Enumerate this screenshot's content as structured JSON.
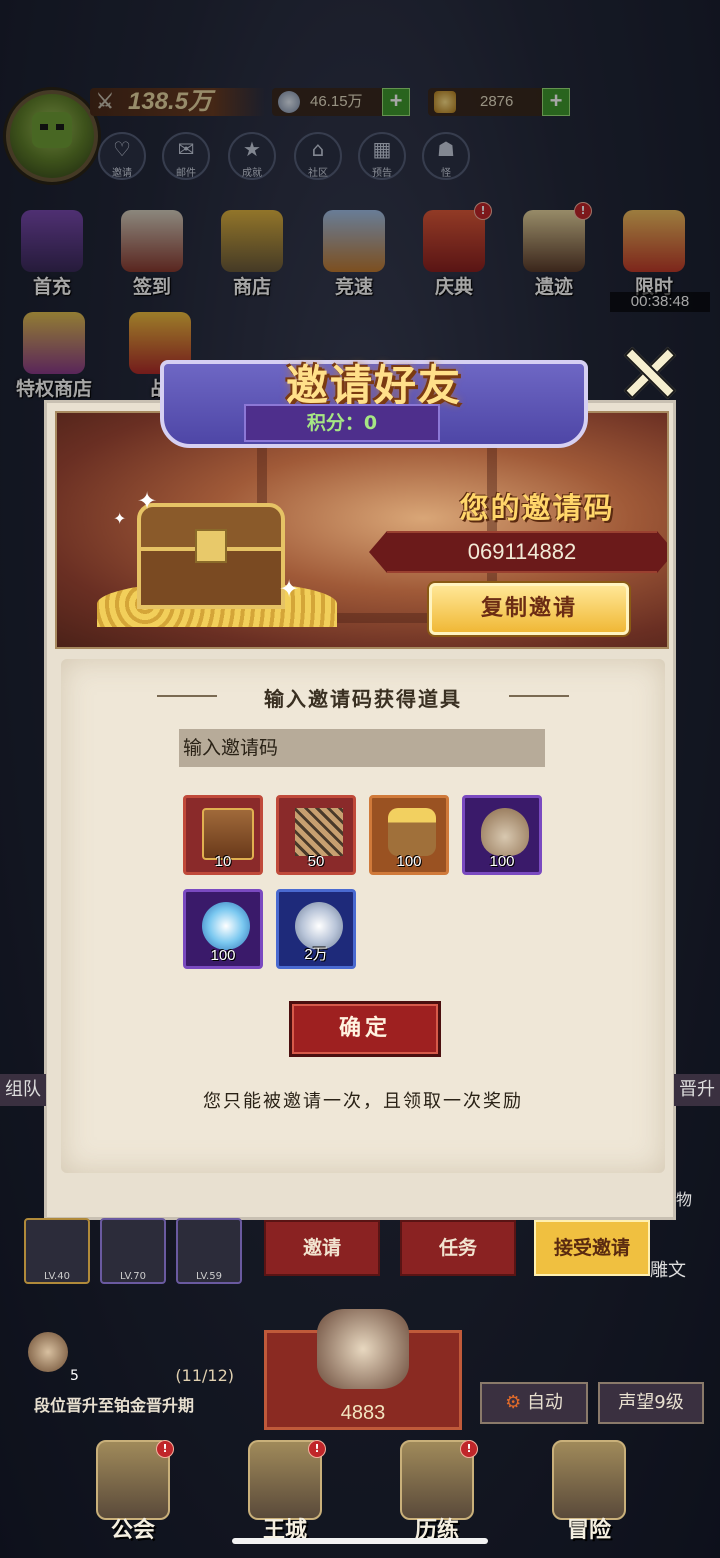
{
  "top_bar": {
    "power": "138.5万",
    "silver": "46.15万",
    "gold": "2876"
  },
  "top_icons": [
    {
      "label": "邀请"
    },
    {
      "label": "邮件"
    },
    {
      "label": "成就"
    },
    {
      "label": "社区"
    },
    {
      "label": "预告"
    },
    {
      "label": "怪"
    }
  ],
  "features_row1": [
    {
      "label": "首充"
    },
    {
      "label": "签到"
    },
    {
      "label": "商店"
    },
    {
      "label": "竞速"
    },
    {
      "label": "庆典"
    },
    {
      "label": "遗迹"
    },
    {
      "label": "限时"
    }
  ],
  "limited_timer": "00:38:48",
  "features_row2": [
    {
      "label": "特权商店"
    },
    {
      "label": "战"
    }
  ],
  "modal": {
    "title": "邀请好友",
    "score_label": "积分：0",
    "your_code_label": "您的邀请码",
    "invite_code": "069114882",
    "copy_button": "复制邀请",
    "section_title": "输入邀请码获得道具",
    "input_placeholder": "输入邀请码",
    "rewards": [
      {
        "name": "scroll-icon",
        "qty": "10",
        "color": "#a63030"
      },
      {
        "name": "net-icon",
        "qty": "50",
        "color": "#a63030"
      },
      {
        "name": "gold-barrel-icon",
        "qty": "100",
        "color": "#a8582a"
      },
      {
        "name": "coin-bag-icon",
        "qty": "100",
        "color": "#5a2a8a"
      },
      {
        "name": "crystal-orb-icon",
        "qty": "100",
        "color": "#5a2a8a"
      },
      {
        "name": "silver-coin-icon",
        "qty": "2万",
        "color": "#2a3aa6"
      }
    ],
    "confirm_button": "确定",
    "notice": "您只能被邀请一次，且领取一次奖励"
  },
  "tabs": [
    {
      "label": "邀请"
    },
    {
      "label": "任务"
    },
    {
      "label": "接受邀请"
    }
  ],
  "side_left": "组队",
  "side_right": "晋升",
  "equipment_slots": [
    {
      "level": "LV.40"
    },
    {
      "level": "LV.70"
    },
    {
      "level": "LV.59"
    }
  ],
  "right_fragment": "雕文",
  "right_fragment_top": "物",
  "quest": {
    "count": "5",
    "progress": "(11/12)",
    "text": "段位晋升至铂金晋升期"
  },
  "chest_value": "4883",
  "auto_button": "自动",
  "reputation": "声望9级",
  "bottom_nav": [
    {
      "label": "公会"
    },
    {
      "label": "王城"
    },
    {
      "label": "历练"
    },
    {
      "label": "冒险"
    }
  ]
}
